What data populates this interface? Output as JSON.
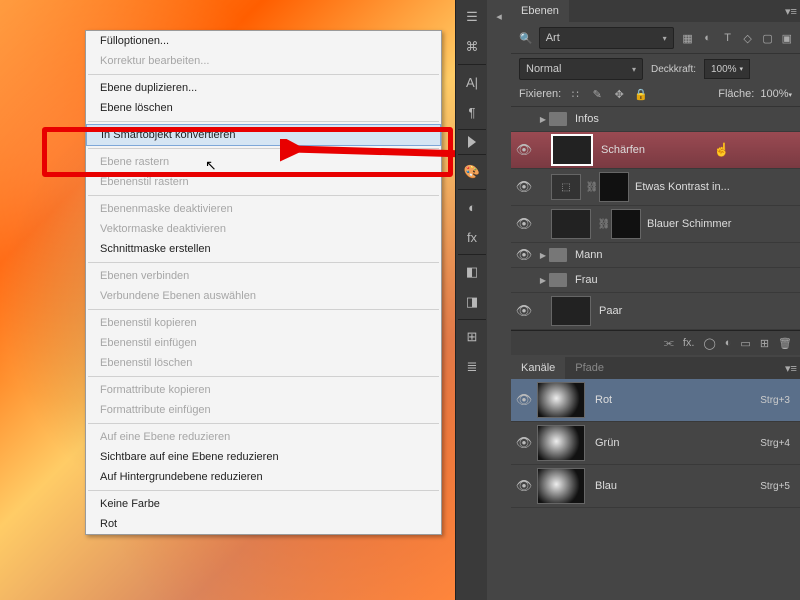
{
  "contextMenu": {
    "items": [
      {
        "label": "Fülloptionen..."
      },
      {
        "label": "Korrektur bearbeiten...",
        "disabled": true
      },
      {
        "sep": true
      },
      {
        "label": "Ebene duplizieren..."
      },
      {
        "label": "Ebene löschen"
      },
      {
        "sep": true
      },
      {
        "label": "In Smartobjekt konvertieren",
        "highlight": true
      },
      {
        "sep": true
      },
      {
        "label": "Ebene rastern",
        "disabled": true
      },
      {
        "label": "Ebenenstil rastern",
        "disabled": true
      },
      {
        "sep": true
      },
      {
        "label": "Ebenenmaske deaktivieren",
        "disabled": true
      },
      {
        "label": "Vektormaske deaktivieren",
        "disabled": true
      },
      {
        "label": "Schnittmaske erstellen"
      },
      {
        "sep": true
      },
      {
        "label": "Ebenen verbinden",
        "disabled": true
      },
      {
        "label": "Verbundene Ebenen auswählen",
        "disabled": true
      },
      {
        "sep": true
      },
      {
        "label": "Ebenenstil kopieren",
        "disabled": true
      },
      {
        "label": "Ebenenstil einfügen",
        "disabled": true
      },
      {
        "label": "Ebenenstil löschen",
        "disabled": true
      },
      {
        "sep": true
      },
      {
        "label": "Formattribute kopieren",
        "disabled": true
      },
      {
        "label": "Formattribute einfügen",
        "disabled": true
      },
      {
        "sep": true
      },
      {
        "label": "Auf eine Ebene reduzieren",
        "disabled": true
      },
      {
        "label": "Sichtbare auf eine Ebene reduzieren"
      },
      {
        "label": "Auf Hintergrundebene reduzieren"
      },
      {
        "sep": true
      },
      {
        "label": "Keine Farbe"
      },
      {
        "label": "Rot"
      }
    ]
  },
  "layersPanel": {
    "title": "Ebenen",
    "filterKind": "Art",
    "blendMode": "Normal",
    "opacityLabel": "Deckkraft:",
    "opacityValue": "100%",
    "lockLabel": "Fixieren:",
    "fillLabel": "Fläche:",
    "fillValue": "100%",
    "layers": [
      {
        "type": "group",
        "name": "Infos",
        "vis": false,
        "indent": 0
      },
      {
        "type": "layer",
        "name": "Schärfen",
        "vis": true,
        "thumb": "th-fire",
        "selected": true,
        "indent": 1
      },
      {
        "type": "adj",
        "name": "Etwas Kontrast in...",
        "vis": true,
        "indent": 1,
        "mask": true
      },
      {
        "type": "layer",
        "name": "Blauer Schimmer",
        "vis": true,
        "thumb": "th-teal",
        "indent": 1,
        "mask": true
      },
      {
        "type": "group",
        "name": "Mann",
        "vis": true,
        "indent": 0
      },
      {
        "type": "group",
        "name": "Frau",
        "vis": false,
        "indent": 0
      },
      {
        "type": "layer",
        "name": "Paar",
        "vis": true,
        "thumb": "th-pair",
        "indent": 1
      }
    ],
    "footerText": "fx."
  },
  "channelsPanel": {
    "tab1": "Kanäle",
    "tab2": "Pfade",
    "channels": [
      {
        "name": "Rot",
        "shortcut": "Strg+3"
      },
      {
        "name": "Grün",
        "shortcut": "Strg+4"
      },
      {
        "name": "Blau",
        "shortcut": "Strg+5"
      }
    ]
  },
  "icons": {
    "search": "🔍",
    "eye": "👁",
    "dropdown": "▾",
    "chain": "⛓",
    "image": "▦",
    "fx": "fx",
    "circle": "◐",
    "text": "T",
    "shape": "◇",
    "smart": "▢",
    "toggle": "▣",
    "lock": "🔒",
    "move": "✥",
    "brush": "✎",
    "trash": "🗑",
    "newlayer": "⊞",
    "mask": "◐",
    "folder": "📁",
    "menu": "▤",
    "link": "⫘",
    "dots": "∷"
  }
}
